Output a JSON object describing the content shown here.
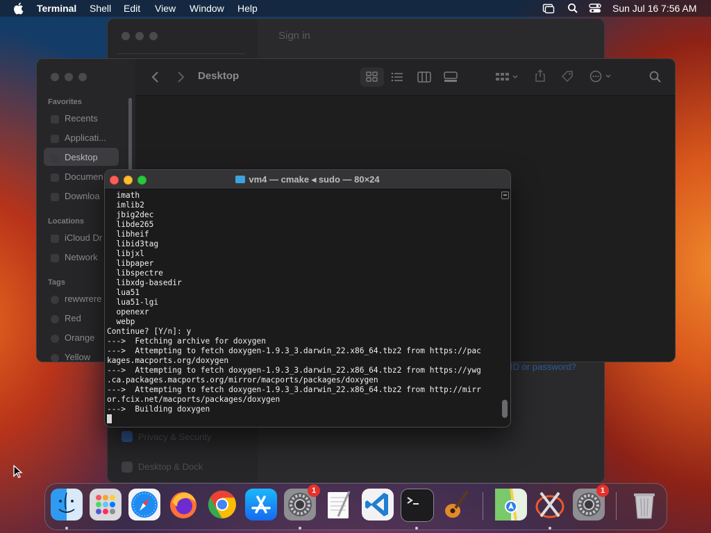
{
  "menubar": {
    "app_name": "Terminal",
    "items": [
      "Shell",
      "Edit",
      "View",
      "Window",
      "Help"
    ],
    "datetime": "Sun Jul 16  7:56 AM",
    "status_icons": [
      "screen-mirroring-icon",
      "search-icon",
      "control-center-icon"
    ]
  },
  "settings_window": {
    "signin_label": "Sign in",
    "forgot_link": "ID or password?",
    "sidebar_items": [
      "Privacy & Security",
      "Desktop & Dock"
    ]
  },
  "finder": {
    "title": "Desktop",
    "sections": [
      {
        "label": "Favorites",
        "items": [
          "Recents",
          "Applicati...",
          "Desktop",
          "Documen",
          "Downloa"
        ]
      },
      {
        "label": "Locations",
        "items": [
          "iCloud Dr",
          "Network"
        ]
      },
      {
        "label": "Tags",
        "items": [
          "rewwrere",
          "Red",
          "Orange",
          "Yellow"
        ]
      }
    ],
    "selected_item": "Desktop",
    "toolbar_icons": [
      "back-icon",
      "forward-icon",
      "icon-view-icon",
      "list-view-icon",
      "column-view-icon",
      "gallery-view-icon",
      "group-icon",
      "share-icon",
      "tag-icon",
      "more-icon",
      "search-icon"
    ]
  },
  "terminal": {
    "title": "vm4 — cmake ◂ sudo — 80×24",
    "scroll_position": 0.97,
    "lines": [
      "  imath",
      "  imlib2",
      "  jbig2dec",
      "  libde265",
      "  libheif",
      "  libid3tag",
      "  libjxl",
      "  libpaper",
      "  libspectre",
      "  libxdg-basedir",
      "  lua51",
      "  lua51-lgi",
      "  openexr",
      "  webp",
      "Continue? [Y/n]: y",
      "--->  Fetching archive for doxygen",
      "--->  Attempting to fetch doxygen-1.9.3_3.darwin_22.x86_64.tbz2 from https://pac",
      "kages.macports.org/doxygen",
      "--->  Attempting to fetch doxygen-1.9.3_3.darwin_22.x86_64.tbz2 from https://ywg",
      ".ca.packages.macports.org/mirror/macports/packages/doxygen",
      "--->  Attempting to fetch doxygen-1.9.3_3.darwin_22.x86_64.tbz2 from http://mirr",
      "or.fcix.net/macports/packages/doxygen",
      "--->  Building doxygen"
    ]
  },
  "dock": {
    "apps": [
      {
        "name": "Finder",
        "icon": "finder-icon",
        "running": true
      },
      {
        "name": "Launchpad",
        "icon": "launchpad-icon",
        "running": false
      },
      {
        "name": "Safari",
        "icon": "safari-icon",
        "running": false
      },
      {
        "name": "Firefox",
        "icon": "firefox-icon",
        "running": false
      },
      {
        "name": "Chrome",
        "icon": "chrome-icon",
        "running": false
      },
      {
        "name": "App Store",
        "icon": "app-store-icon",
        "running": false
      },
      {
        "name": "System Settings",
        "icon": "system-settings-icon",
        "running": true,
        "badge": "1"
      },
      {
        "name": "TextEdit",
        "icon": "textedit-icon",
        "running": false
      },
      {
        "name": "Visual Studio Code",
        "icon": "vscode-icon",
        "running": false
      },
      {
        "name": "Terminal",
        "icon": "terminal-icon",
        "running": true
      },
      {
        "name": "GarageBand",
        "icon": "garageband-icon",
        "running": false
      },
      {
        "name": "Maps",
        "icon": "maps-icon",
        "running": false
      },
      {
        "name": "XQuartz",
        "icon": "xquartz-icon",
        "running": true
      },
      {
        "name": "System Settings",
        "icon": "system-settings-icon",
        "running": false,
        "badge": "1"
      },
      {
        "name": "Trash",
        "icon": "trash-icon",
        "running": false
      }
    ]
  }
}
